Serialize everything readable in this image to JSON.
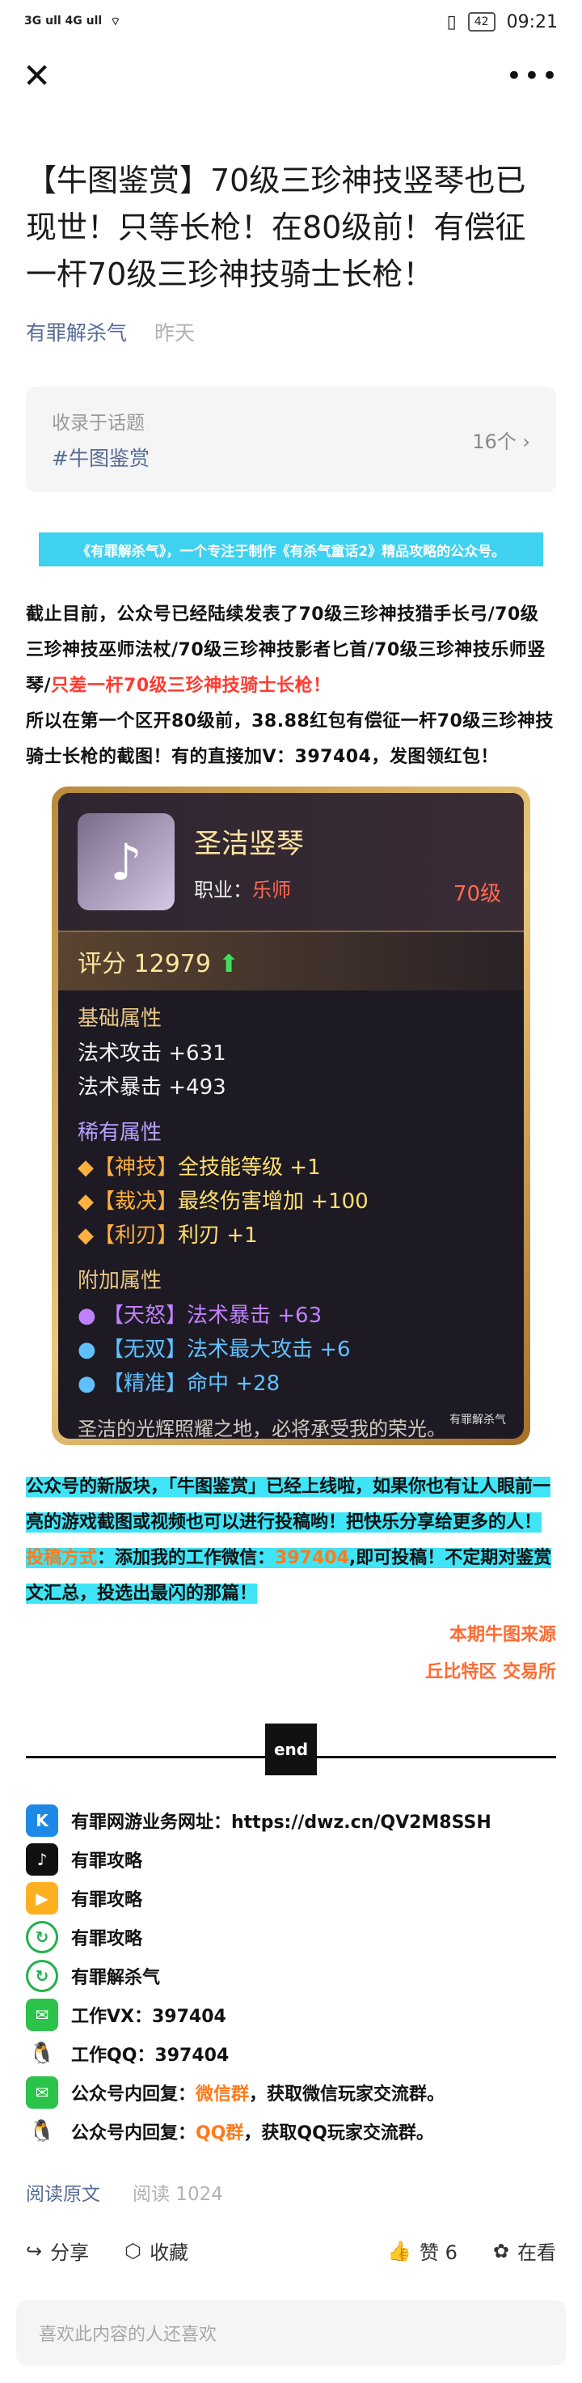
{
  "status_bar": {
    "signal_left": "3G ull 4G ull",
    "battery": "42",
    "time": "09:21"
  },
  "nav": {
    "close_icon": "close-icon",
    "more_icon": "more-icon"
  },
  "article": {
    "title": "【牛图鉴赏】70级三珍神技竖琴也已现世！只等长枪！在80级前！有偿征一杆70级三珍神技骑士长枪！",
    "author": "有罪解杀气",
    "date": "昨天"
  },
  "topic": {
    "label": "收录于话题",
    "tag": "#牛图鉴赏",
    "count": "16个"
  },
  "banner": "《有罪解杀气》，一个专注于制作《有杀气童话2》精品攻略的公众号。",
  "para1": {
    "text": "截止目前，公众号已经陆续发表了70级三珍神技猎手长弓/70级三珍神技巫师法杖/70级三珍神技影者匕首/70级三珍神技乐师竖琴/",
    "red": "只差一杆70级三珍神技骑士长枪！"
  },
  "para2": "所以在第一个区开80级前，38.88红包有偿征一杆70级三珍神技骑士长枪的截图！有的直接加V：397404，发图领红包！",
  "item_card": {
    "name": "圣洁竖琴",
    "class_label": "职业：",
    "class_value": "乐师",
    "level": "70级",
    "score_label": "评分",
    "score": "12979",
    "base_header": "基础属性",
    "base": [
      "法术攻击 +631",
      "法术暴击 +493"
    ],
    "rare_header": "稀有属性",
    "rare": [
      {
        "tag": "【神技】",
        "name": "全技能等级",
        "val": "+1"
      },
      {
        "tag": "【裁决】",
        "name": "最终伤害增加",
        "val": "+100"
      },
      {
        "tag": "【利刃】",
        "name": "利刃",
        "val": "+1"
      }
    ],
    "extra_header": "附加属性",
    "extra": [
      {
        "tag": "【天怒】",
        "name": "法术暴击",
        "val": "+63"
      },
      {
        "tag": "【无双】",
        "name": "法术最大攻击",
        "val": "+6"
      },
      {
        "tag": "【精准】",
        "name": "命中",
        "val": "+28"
      }
    ],
    "desc": "圣洁的光辉照耀之地，必将承受我的荣光。",
    "watermark": "有罪解杀气"
  },
  "highlight": {
    "line1": "公众号的新版块，「牛图鉴赏」已经上线啦，如果你也有让人眼前一亮的游戏截图或视频也可以进行投稿哟！把快乐分享给更多的人！",
    "contrib_label": "投稿方式",
    "contrib_text_a": "：添加我的工作微信：",
    "wechat": "397404",
    "contrib_text_b": ",即可投稿！不定期对鉴赏文汇总，投选出最闪的那篇！"
  },
  "source": {
    "line1": "本期牛图来源",
    "line2": "丘比特区 交易所"
  },
  "end_label": "end",
  "links": [
    {
      "icon": "kuaikan-icon",
      "text": "有罪网游业务网址：https://dwz.cn/QV2M8SSH"
    },
    {
      "icon": "tiktok-icon",
      "text": "有罪攻略"
    },
    {
      "icon": "kuaishou-icon",
      "text": "有罪攻略"
    },
    {
      "icon": "refresh-green-icon",
      "text": "有罪攻略"
    },
    {
      "icon": "refresh-green-icon",
      "text": "有罪解杀气"
    },
    {
      "icon": "wechat-icon",
      "text": "工作VX：397404"
    },
    {
      "icon": "qq-icon",
      "text": "工作QQ：397404"
    }
  ],
  "reply_rows": [
    {
      "icon": "wechat-icon",
      "pre": "公众号内回复：",
      "key": "微信群",
      "post": "，获取微信玩家交流群。"
    },
    {
      "icon": "qq-icon",
      "pre": "公众号内回复：",
      "key": "QQ群",
      "post": "，获取QQ玩家交流群。"
    }
  ],
  "footer": {
    "read_original": "阅读原文",
    "read_count": "阅读 1024"
  },
  "actions": {
    "share": "分享",
    "fav": "收藏",
    "like": "赞 6",
    "watching": "在看"
  },
  "comment_placeholder": "喜欢此内容的人还喜欢"
}
